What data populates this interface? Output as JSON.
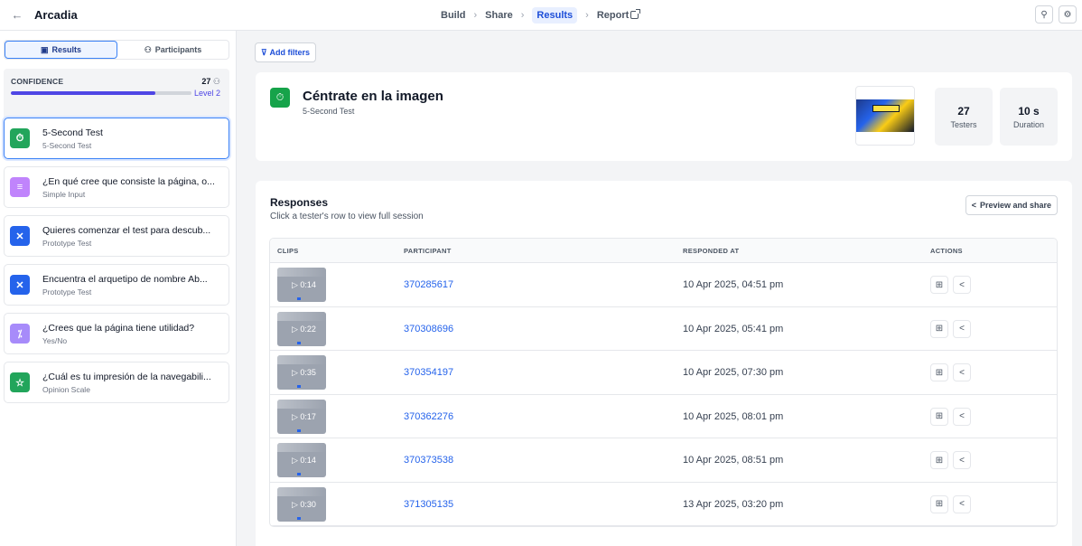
{
  "topbar": {
    "title": "Arcadia",
    "steps": [
      "Build",
      "Share",
      "Results",
      "Report"
    ],
    "active_step": "Results"
  },
  "sidebar": {
    "tabs": {
      "results": "Results",
      "participants": "Participants"
    },
    "confidence": {
      "label": "CONFIDENCE",
      "count": "27",
      "level": "Level 2",
      "progress": 0.8
    },
    "items": [
      {
        "title": "5-Second Test",
        "type": "5-Second Test",
        "color": "#22a55b",
        "icon": "timer-icon"
      },
      {
        "title": "¿En qué cree que consiste la página, o...",
        "type": "Simple Input",
        "color": "#c084fc",
        "icon": "text-input-icon"
      },
      {
        "title": "Quieres comenzar el test para descub...",
        "type": "Prototype Test",
        "color": "#2563eb",
        "icon": "prototype-icon"
      },
      {
        "title": "Encuentra el arquetipo de nombre Ab...",
        "type": "Prototype Test",
        "color": "#2563eb",
        "icon": "prototype-icon"
      },
      {
        "title": "¿Crees que la página tiene utilidad?",
        "type": "Yes/No",
        "color": "#a78bfa",
        "icon": "yes-no-icon"
      },
      {
        "title": "¿Cuál es tu impresión de la navegabili...",
        "type": "Opinion Scale",
        "color": "#22a55b",
        "icon": "star-icon"
      }
    ]
  },
  "filters": {
    "label": "Add filters"
  },
  "summary": {
    "title": "Céntrate en la imagen",
    "subtitle": "5-Second Test",
    "testers_value": "27",
    "testers_label": "Testers",
    "duration_value": "10 s",
    "duration_label": "Duration"
  },
  "responses": {
    "title": "Responses",
    "subtitle": "Click a tester's row to view full session",
    "preview_label": "Preview and share",
    "headers": [
      "CLIPS",
      "PARTICIPANT",
      "RESPONDED AT",
      "ACTIONS"
    ],
    "rows": [
      {
        "clip": "▷ 0:14",
        "participant": "370285617",
        "responded": "10 Apr 2025, 04:51 pm"
      },
      {
        "clip": "▷ 0:22",
        "participant": "370308696",
        "responded": "10 Apr 2025, 05:41 pm"
      },
      {
        "clip": "▷ 0:35",
        "participant": "370354197",
        "responded": "10 Apr 2025, 07:30 pm"
      },
      {
        "clip": "▷ 0:17",
        "participant": "370362276",
        "responded": "10 Apr 2025, 08:01 pm"
      },
      {
        "clip": "▷ 0:14",
        "participant": "370373538",
        "responded": "10 Apr 2025, 08:51 pm"
      },
      {
        "clip": "▷ 0:30",
        "participant": "371305135",
        "responded": "13 Apr 2025, 03:20 pm"
      }
    ]
  }
}
